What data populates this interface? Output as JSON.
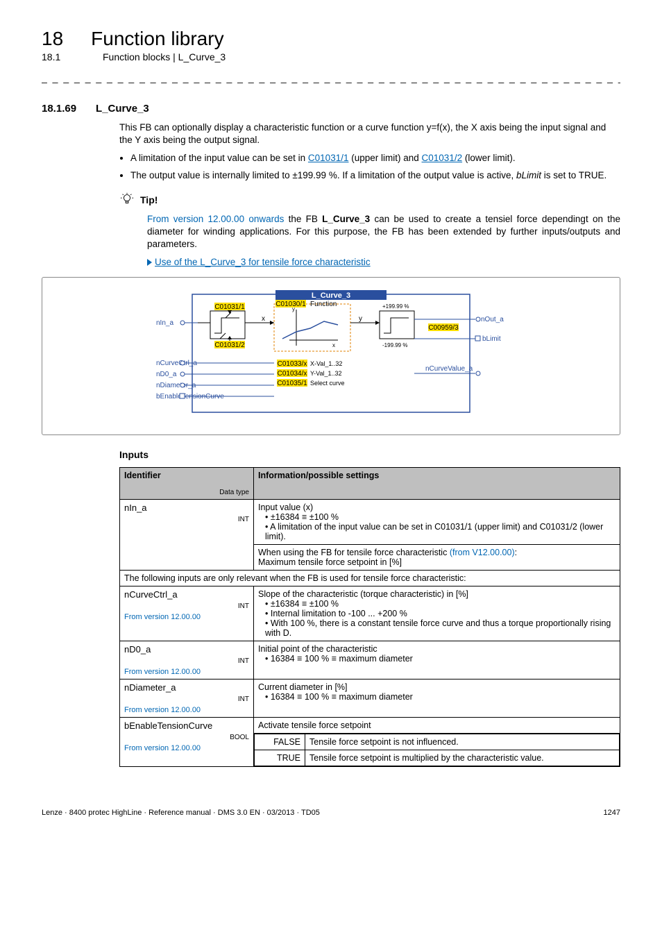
{
  "chapter": {
    "num": "18",
    "title": "Function library"
  },
  "subsection": {
    "num": "18.1",
    "title": "Function blocks | L_Curve_3"
  },
  "dashes": "_ _ _ _ _ _ _ _ _ _ _ _ _ _ _ _ _ _ _ _ _ _ _ _ _ _ _ _ _ _ _ _ _ _ _ _ _ _ _ _ _ _ _ _ _ _ _ _ _ _ _ _ _ _ _ _ _ _ _ _ _ _ _ _",
  "section": {
    "num": "18.1.69",
    "title": "L_Curve_3"
  },
  "para1": "This FB can optionally display a characteristic function or a curve function y=f(x), the X axis being the input signal and the Y axis being the output signal.",
  "bullet1a": "A limitation of the input value can be set in ",
  "bullet1_link1": "C01031/1",
  "bullet1b": " (upper limit) and ",
  "bullet1_link2": "C01031/2",
  "bullet1c": " (lower limit).",
  "bullet2": "The output value is internally limited to ±199.99 %. If a limitation of the output value is active, bLimit is set to TRUE.",
  "tip_label": "Tip!",
  "tip_body_blue": "From version 12.00.00 onwards",
  "tip_body_rest": " the FB L_Curve_3 can be used to create a tensiel force dependingt on the diameter for winding applications. For this purpose, the FB has been extended by further inputs/outputs and parameters.",
  "tri_link_text": "Use of the L_Curve_3 for tensile force characteristic",
  "diagram": {
    "title": "L_Curve_3",
    "c_upper": "C01031/1",
    "c_lower": "C01031/2",
    "c_func": "C01030/1",
    "func_label": "Function",
    "x": "x",
    "y": "y",
    "cx1": "C01033/x",
    "cx1_lab": "X-Val_1..32",
    "cx2": "C01034/x",
    "cx2_lab": "Y-Val_1..32",
    "cx3": "C01035/1",
    "cx3_lab": "Select curve",
    "in1": "nIn_a",
    "in2": "nCurveCtrl_a",
    "in3": "nD0_a",
    "in4": "nDiameter_a",
    "in5": "bEnableTensionCurve",
    "out1": "nOut_a",
    "out1_code": "C00959/3",
    "out2": "bLimit",
    "out3": "nCurveValue_a",
    "lim_hi": "+199.99 %",
    "lim_lo": "-199.99 %"
  },
  "inputs_label": "Inputs",
  "table": {
    "h1": "Identifier",
    "h1_sub": "Data type",
    "h2": "Information/possible settings",
    "r1_name": "nIn_a",
    "r1_dt": "INT",
    "r1_info_l1": "Input value (x)",
    "r1_info_l2": "• ±16384 ≡ ±100 %",
    "r1_info_l3": "• A limitation of the input value can be set in C01031/1 (upper limit) and C01031/2 (lower limit).",
    "r1b_info_a": "When using the FB for tensile force characteristic ",
    "r1b_info_blue": "(from V12.00.00)",
    "r1b_info_b": ":",
    "r1b_info_l2": "Maximum tensile force setpoint in [%]",
    "span_row": "The following inputs are only relevant when the FB is used for tensile force characteristic:",
    "r2_name": "nCurveCtrl_a",
    "r2_dt": "INT",
    "r2_ver": "From version 12.00.00",
    "r2_l1": "Slope of the characteristic (torque characteristic) in [%]",
    "r2_l2": "• ±16384 ≡ ±100 %",
    "r2_l3": "• Internal limitation to -100 ... +200 %",
    "r2_l4": "• With 100 %, there is a constant tensile force curve and thus a torque proportionally rising with D.",
    "r3_name": "nD0_a",
    "r3_dt": "INT",
    "r3_ver": "From version 12.00.00",
    "r3_l1": "Initial point of the characteristic",
    "r3_l2": "• 16384 ≡ 100 % ≡ maximum diameter",
    "r4_name": "nDiameter_a",
    "r4_dt": "INT",
    "r4_ver": "From version 12.00.00",
    "r4_l1": "Current diameter in [%]",
    "r4_l2": "• 16384 ≡ 100 % ≡ maximum diameter",
    "r5_name": "bEnableTensionCurve",
    "r5_dt": "BOOL",
    "r5_ver": "From version 12.00.00",
    "r5_l1": "Activate tensile force setpoint",
    "r5_false": "FALSE",
    "r5_false_txt": "Tensile force setpoint is not influenced.",
    "r5_true": "TRUE",
    "r5_true_txt": "Tensile force setpoint is multiplied by the characteristic value."
  },
  "footer_left": "Lenze · 8400 protec HighLine · Reference manual · DMS 3.0 EN · 03/2013 · TD05",
  "footer_right": "1247"
}
